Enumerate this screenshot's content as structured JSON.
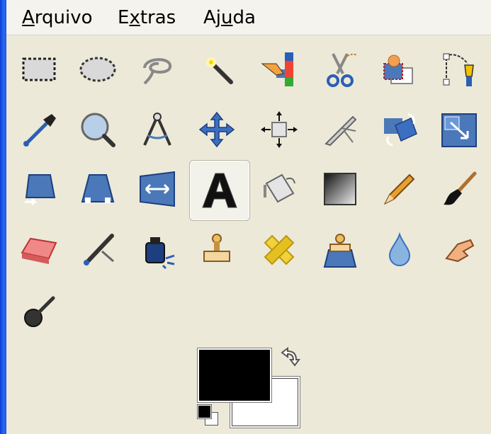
{
  "menubar": {
    "arquivo": {
      "prefix": "",
      "mnemonic": "A",
      "rest": "rquivo"
    },
    "extras": {
      "prefix": "E",
      "mnemonic": "x",
      "rest": "tras"
    },
    "ajuda": {
      "prefix": "Aj",
      "mnemonic": "u",
      "rest": "da"
    }
  },
  "toolbox": {
    "active_tool": "text-tool",
    "tools": [
      "rect-select-icon",
      "ellipse-select-icon",
      "free-select-icon",
      "fuzzy-select-icon",
      "color-select-icon",
      "scissors-icon",
      "foreground-select-icon",
      "paths-icon",
      "color-picker-icon",
      "zoom-icon",
      "measure-icon",
      "move-icon",
      "align-icon",
      "crop-icon",
      "rotate-icon",
      "scale-icon",
      "shear-icon",
      "perspective-icon",
      "flip-icon",
      "text-icon",
      "bucket-fill-icon",
      "blend-icon",
      "pencil-icon",
      "paintbrush-icon",
      "eraser-icon",
      "airbrush-icon",
      "ink-icon",
      "clone-icon",
      "heal-icon",
      "perspective-clone-icon",
      "blur-icon",
      "smudge-icon",
      "dodge-burn-icon"
    ]
  },
  "colors": {
    "foreground": "#000000",
    "background": "#ffffff",
    "accent_blue": "#4a78b8"
  }
}
